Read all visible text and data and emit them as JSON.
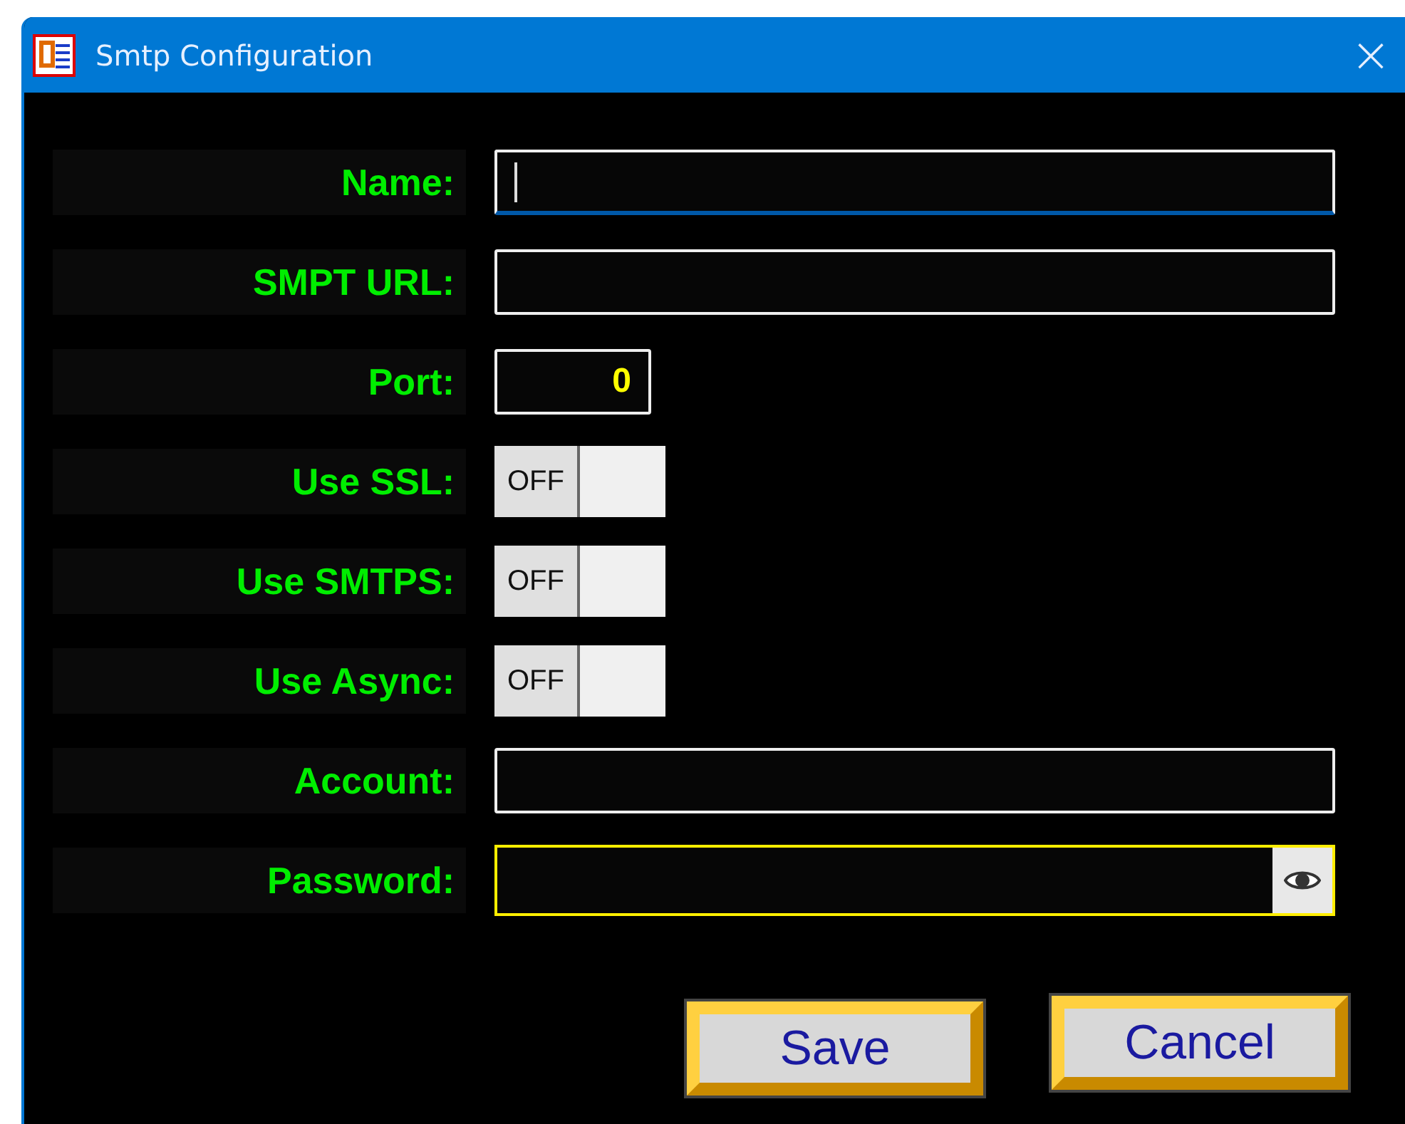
{
  "window": {
    "title": "Smtp Configuration",
    "close": "×"
  },
  "fields": [
    {
      "label": "Name:",
      "kind": "text",
      "focused": true
    },
    {
      "label": "SMPT URL:",
      "kind": "text",
      "focused": false
    },
    {
      "label": "Port:",
      "kind": "number",
      "value": "0",
      "focused": false
    },
    {
      "label": "Use SSL:",
      "kind": "toggle",
      "on": false,
      "state_text": "OFF"
    },
    {
      "label": "Use SMTPS:",
      "kind": "toggle",
      "on": false,
      "state_text": "OFF"
    },
    {
      "label": "Use Async:",
      "kind": "toggle",
      "on": false,
      "state_text": "OFF"
    },
    {
      "label": "Account:",
      "kind": "text",
      "focused": false
    },
    {
      "label": "Password:",
      "kind": "password"
    }
  ],
  "buttons": [
    "Save",
    "Cancel"
  ]
}
